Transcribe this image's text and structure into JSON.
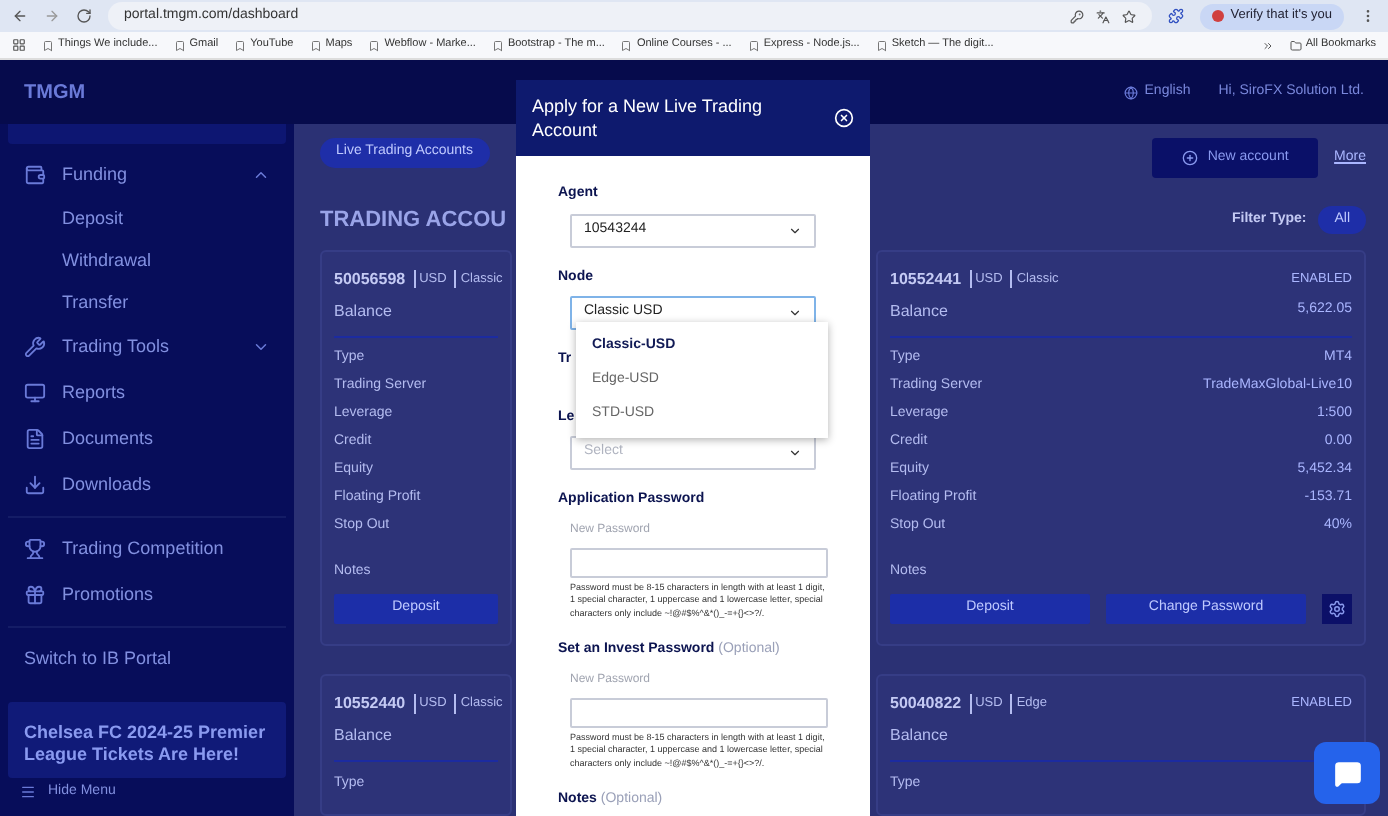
{
  "browser": {
    "url": "portal.tmgm.com/dashboard",
    "profile_chip": "Verify that it's you",
    "bookmarks": [
      "Things We include...",
      "Gmail",
      "YouTube",
      "Maps",
      "Webflow - Marke...",
      "Bootstrap - The m...",
      "Online Courses - ...",
      "Express - Node.js...",
      "Sketch — The digit..."
    ],
    "all_bookmarks": "All Bookmarks"
  },
  "header": {
    "logo": "TMGM",
    "language": "English",
    "greeting": "Hi, SiroFX Solution Ltd."
  },
  "sidebar": {
    "groups": [
      [
        {
          "label": "Funding",
          "expanded": true,
          "children": [
            {
              "label": "Deposit"
            },
            {
              "label": "Withdrawal"
            },
            {
              "label": "Transfer"
            }
          ]
        },
        {
          "label": "Trading Tools",
          "expanded": false
        },
        {
          "label": "Reports"
        },
        {
          "label": "Documents"
        },
        {
          "label": "Downloads"
        }
      ],
      [
        {
          "label": "Trading Competition"
        },
        {
          "label": "Promotions"
        }
      ],
      [
        {
          "label": "Switch to IB Portal"
        }
      ]
    ],
    "banner": "Chelsea FC 2024-25 Premier League Tickets Are Here!",
    "hide_menu": "Hide Menu"
  },
  "main": {
    "tab": "Live Trading Accounts",
    "heading": "TRADING ACCOU",
    "new_account": "New account",
    "more": "More",
    "filter_label": "Filter Type:",
    "filter_value": "All",
    "accounts": [
      {
        "number": "50056598",
        "currency": "USD",
        "mode": "Classic",
        "balance_label": "Balance",
        "rows": [
          {
            "label": "Type"
          },
          {
            "label": "Trading Server"
          },
          {
            "label": "Leverage"
          },
          {
            "label": "Credit"
          },
          {
            "label": "Equity"
          },
          {
            "label": "Floating Profit"
          },
          {
            "label": "Stop Out"
          }
        ],
        "notes_label": "Notes",
        "buttons": [
          "Deposit"
        ]
      },
      {
        "number": "10552441",
        "currency": "USD",
        "mode": "Classic",
        "status": "ENABLED",
        "balance_label": "Balance",
        "balance": "5,622.05",
        "rows": [
          {
            "label": "Type",
            "value": "MT4"
          },
          {
            "label": "Trading Server",
            "value": "TradeMaxGlobal-Live10"
          },
          {
            "label": "Leverage",
            "value": "1:500"
          },
          {
            "label": "Credit",
            "value": "0.00"
          },
          {
            "label": "Equity",
            "value": "5,452.34"
          },
          {
            "label": "Floating Profit",
            "value": "-153.71"
          },
          {
            "label": "Stop Out",
            "value": "40%"
          }
        ],
        "notes_label": "Notes",
        "buttons": [
          "Deposit",
          "Change Password"
        ],
        "settings": true
      },
      {
        "number": "10552440",
        "currency": "USD",
        "mode": "Classic",
        "balance_label": "Balance",
        "rows": [
          {
            "label": "Type"
          }
        ]
      },
      {
        "number": "50040822",
        "currency": "USD",
        "mode": "Edge",
        "status": "ENABLED",
        "balance_label": "Balance",
        "rows": [
          {
            "label": "Type"
          }
        ]
      }
    ]
  },
  "modal": {
    "title": "Apply for a New Live Trading Account",
    "fields": [
      {
        "kind": "select",
        "label": "Agent",
        "value": "10543244",
        "focused": false
      },
      {
        "kind": "select",
        "label": "Node",
        "value": "Classic USD",
        "focused": true
      },
      {
        "kind": "covered",
        "label": "Tr"
      },
      {
        "kind": "select",
        "label": "Le",
        "placeholder": "Select",
        "focused": false
      },
      {
        "kind": "password",
        "label": "Application Password",
        "sublabel": "New Password",
        "help": "Password must be 8-15 characters in length with at least 1 digit, 1 special character, 1 uppercase and 1 lowercase letter, special characters only include ~!@#$%^&*()_-=+{}<>?/."
      },
      {
        "kind": "password",
        "label": "Set an Invest Password",
        "optional": "(Optional)",
        "sublabel": "New Password",
        "help": "Password must be 8-15 characters in length with at least 1 digit, 1 special character, 1 uppercase and 1 lowercase letter, special characters only include ~!@#$%^&*()_-=+{}<>?/."
      },
      {
        "kind": "heading",
        "label": "Notes",
        "optional": "(Optional)"
      }
    ],
    "dropdown": [
      {
        "label": "Classic-USD",
        "selected": true
      },
      {
        "label": "Edge-USD",
        "selected": false
      },
      {
        "label": "STD-USD",
        "selected": false
      }
    ]
  }
}
